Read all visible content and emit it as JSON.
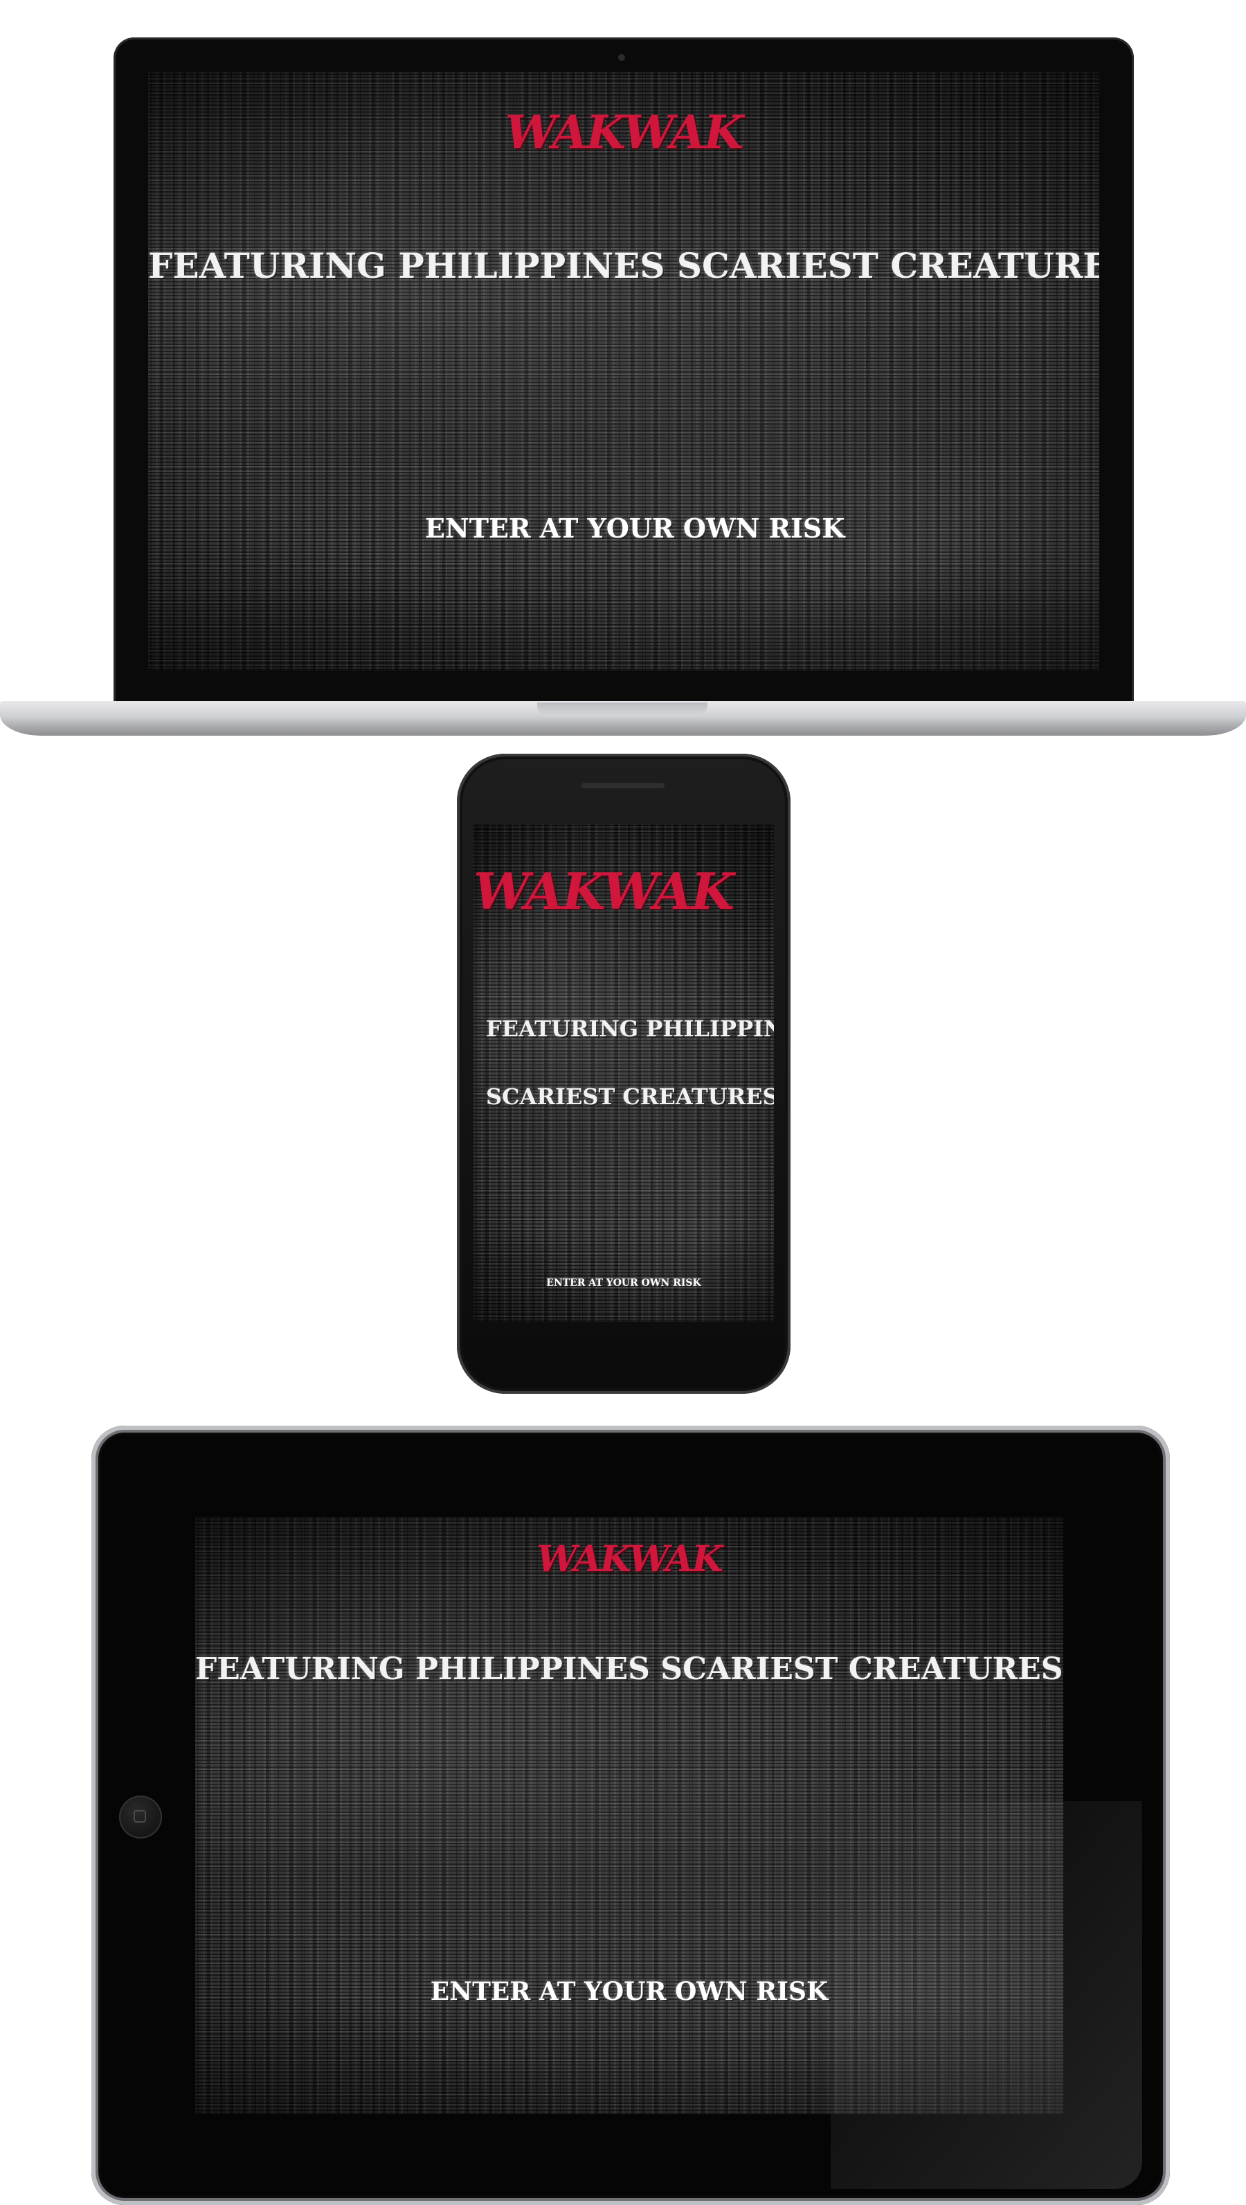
{
  "site": {
    "logo": "WAKWAK",
    "tagline": "FEATURING PHILIPPINES SCARIEST CREATURES",
    "tagline_line1": "FEATURING PHILIPPINES",
    "tagline_line2": "SCARIEST CREATURES",
    "enter_label": "ENTER AT YOUR OWN RISK"
  },
  "colors": {
    "logo": "#d1163c",
    "text": "#f2f2f2",
    "static_background": "#2b2b2b"
  },
  "devices": [
    "laptop",
    "phone",
    "tablet"
  ]
}
